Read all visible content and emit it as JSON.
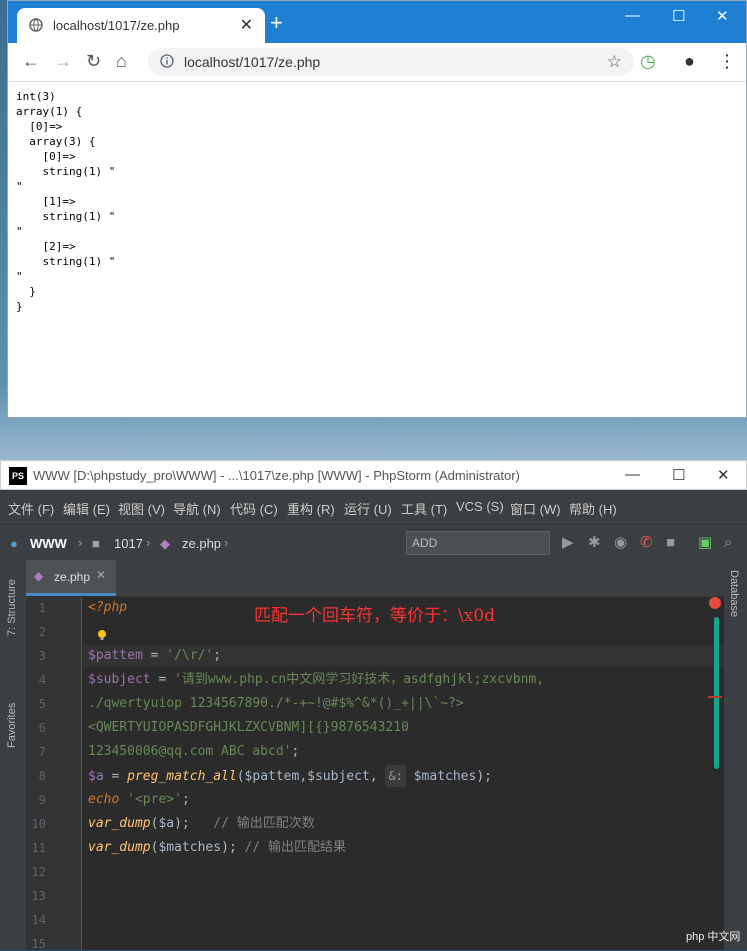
{
  "browser": {
    "tab_title": "localhost/1017/ze.php",
    "url": "localhost/1017/ze.php",
    "output": "int(3)\narray(1) {\n  [0]=>\n  array(3) {\n    [0]=>\n    string(1) \"\n\"\n    [1]=>\n    string(1) \"\n\"\n    [2]=>\n    string(1) \"\n\"\n  }\n}"
  },
  "ide": {
    "title": "WWW [D:\\phpstudy_pro\\WWW] - ...\\1017\\ze.php [WWW] - PhpStorm (Administrator)",
    "menu": [
      "文件 (F)",
      "编辑 (E)",
      "视图 (V)",
      "导航 (N)",
      "代码 (C)",
      "重构 (R)",
      "运行 (U)",
      "工具 (T)",
      "VCS (S)",
      "窗口 (W)",
      "帮助 (H)"
    ],
    "breadcrumbs": [
      "WWW",
      "1017",
      "ze.php"
    ],
    "add_configuration": "ADD CONFIGURATION...",
    "file_tab": "ze.php",
    "strip_structure": "7: Structure",
    "strip_favorites": "Favorites",
    "strip_database": "Database",
    "annotation": "匹配一个回车符，等价于：\\x0d",
    "line_numbers": [
      "1",
      "2",
      "3",
      "4",
      "5",
      "6",
      "7",
      "8",
      "9",
      "10",
      "11",
      "12",
      "13",
      "14",
      "15"
    ],
    "code": {
      "l1": "<?php",
      "l3_var": "$pattem",
      "l3_rest": " = ",
      "l3_str": "'/\\r/'",
      "l3_end": ";",
      "l4_var": "$subject",
      "l4_rest": " = ",
      "l4_str": "'请到www.php.cn中文网学习好技术，asdfghjkl;zxcvbnm,",
      "l5_str": "./qwertyuiop 1234567890./*-+~!@#$%^&*()_+||\\`~?>",
      "l6_str": "<QWERTYUIOPASDFGHJKLZXCVBNM][{}9876543210",
      "l7_str": "123450006@qq.com ABC abcd'",
      "l7_end": ";",
      "l8_var": "$a",
      "l8_eq": " = ",
      "l8_fn": "preg_match_all",
      "l8_args": "($pattem,$subject, ",
      "l8_hint": "&:",
      "l8_args2": " $matches);",
      "l9_kw": "echo",
      "l9_str": " '<pre>'",
      "l9_end": ";",
      "l10_fn": "var_dump",
      "l10_args": "($a);",
      "l10_cmt": "   // 输出匹配次数",
      "l11_fn": "var_dump",
      "l11_args": "($matches);",
      "l11_cmt": " // 输出匹配结果"
    }
  },
  "watermark": "php 中文网"
}
